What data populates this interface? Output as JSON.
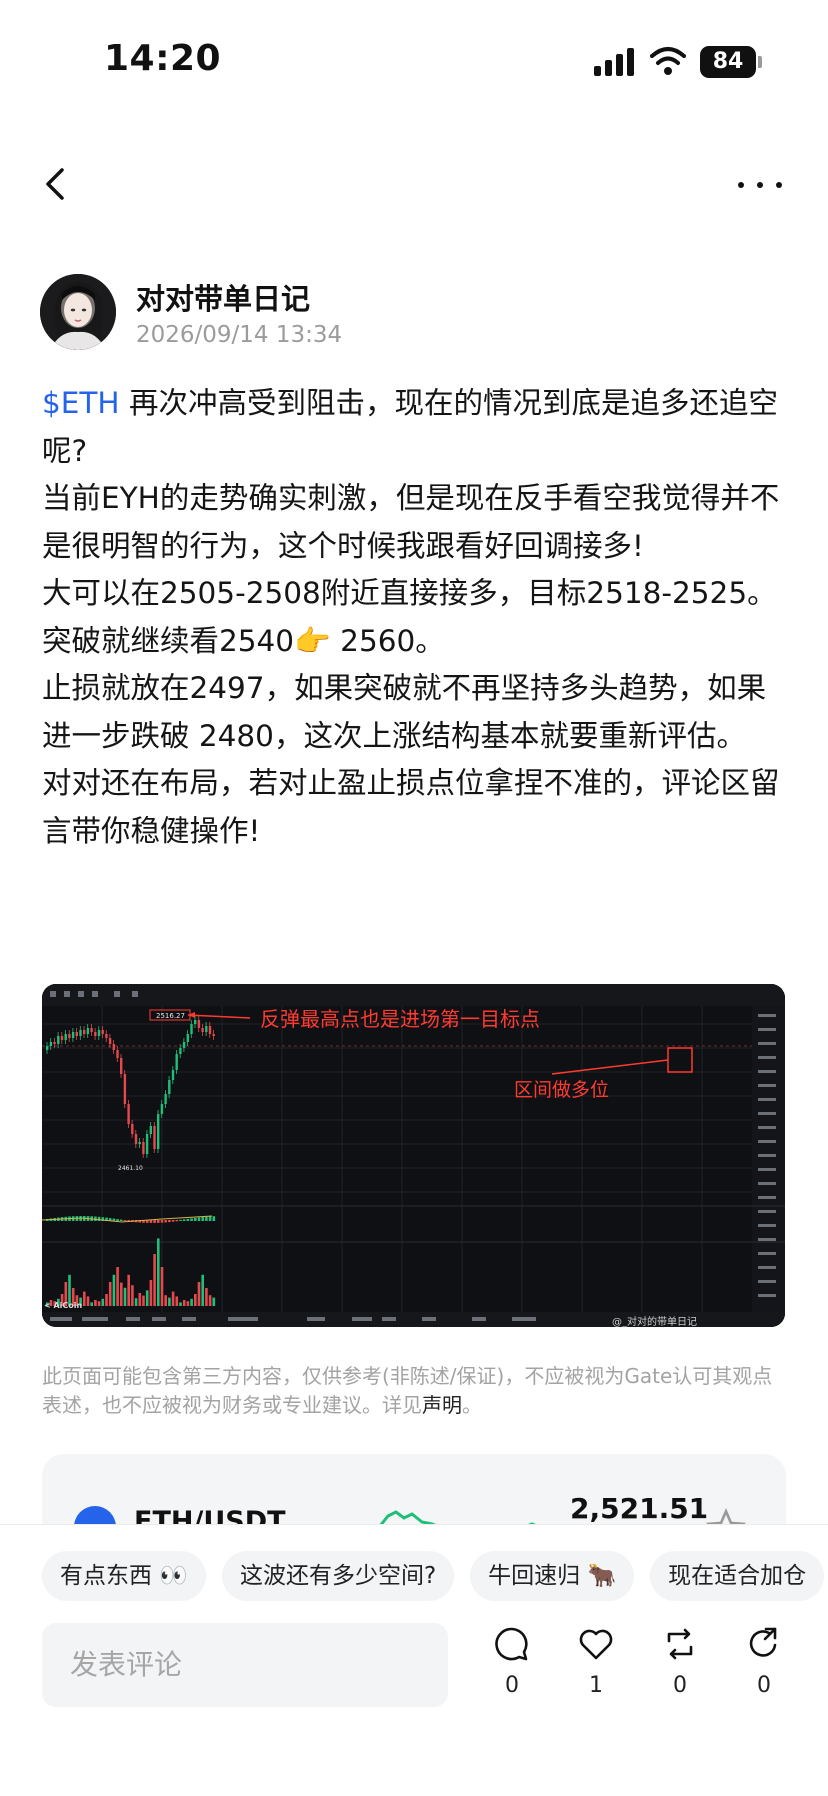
{
  "status_bar": {
    "time": "14:20",
    "battery": "84"
  },
  "author": {
    "name": "对对带单日记",
    "timestamp": "2026/09/14 13:34"
  },
  "post": {
    "ticker": "$ETH",
    "line1": " 再次冲高受到阻击，现在的情况到底是追多还追空呢?",
    "line2": "当前EYH的走势确实刺激，但是现在反手看空我觉得并不是很明智的行为，这个时候我跟看好回调接多!",
    "line3": "大可以在2505-2508附近直接接多，目标2518-2525。",
    "line4": "突破就继续看2540👉 2560。",
    "line5": "止损就放在2497，如果突破就不再坚持多头趋势，如果进一步跌破 2480，这次上涨结构基本就要重新评估。",
    "line6": "对对还在布局，若对止盈止损点位拿捏不准的，评论区留言带你稳健操作!"
  },
  "chart_image": {
    "annotation_top": "反弹最高点也是进场第一目标点",
    "annotation_right": "区间做多位",
    "high_label": "2516.27",
    "low_label": "2461.10",
    "watermark": "@_对对的带单日记"
  },
  "disclaimer": {
    "text": "此页面可能包含第三方内容，仅供参考(非陈述/保证)，不应被视为Gate认可其观点表述，也不应被视为财务或专业建议。详见",
    "link": "声明",
    "end": "。"
  },
  "token_card": {
    "pair": "ETH/USDT",
    "price": "2,521.51"
  },
  "quick_replies": [
    "有点东西 👀",
    "这波还有多少空间?",
    "牛回速归 🐂",
    "现在适合加仓"
  ],
  "comment_box": {
    "placeholder": "发表评论"
  },
  "actions": {
    "comments": "0",
    "likes": "1",
    "reposts": "0",
    "shares": "0"
  },
  "colors": {
    "accent_blue": "#2563eb",
    "candle_up": "#1fbf7a",
    "candle_down": "#e5484d",
    "annotation_red": "#ff3b30"
  }
}
